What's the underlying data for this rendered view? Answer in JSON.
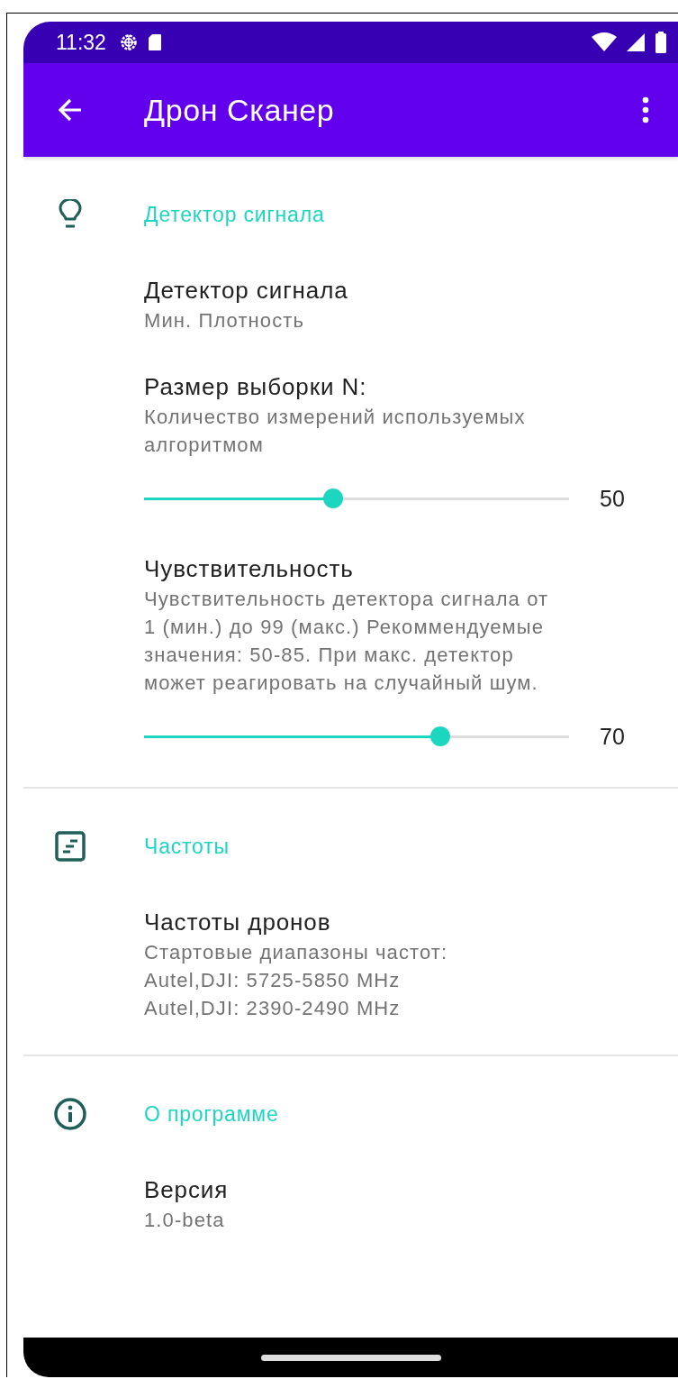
{
  "status_bar": {
    "time": "11:32"
  },
  "app_bar": {
    "title": "Дрон Сканер"
  },
  "sections": [
    {
      "kind": "signal",
      "title": "Детектор сигнала",
      "items": [
        {
          "kind": "text",
          "title": "Детектор сигнала",
          "summary": [
            "Мин. Плотность"
          ]
        },
        {
          "kind": "slider",
          "title": "Размер выборки N:",
          "summary": [
            "Количество измерений используемых",
            "алгоритмом"
          ],
          "level": 0.445,
          "reading": "50"
        },
        {
          "kind": "slider",
          "title": "Чувствительность",
          "summary": [
            "Чувствительность детектора сигнала от",
            "1 (мин.) до 99 (макс.) Рекоммендуемые",
            "значения: 50-85. При макс. детектор",
            "может реагировать на случайный шум."
          ],
          "level": 0.697,
          "reading": "70"
        }
      ]
    },
    {
      "kind": "list",
      "title": "Частоты",
      "items": [
        {
          "kind": "text",
          "title": "Частоты дронов",
          "summary": [
            "Стартовые диапазоны частот:",
            "Autel,DJI: 5725-5850 MHz",
            "Autel,DJI: 2390-2490 MHz"
          ]
        }
      ]
    },
    {
      "kind": "info",
      "title": "О программе",
      "items": [
        {
          "kind": "text",
          "title": "Версия",
          "summary": [
            "1.0-beta"
          ]
        }
      ]
    }
  ]
}
